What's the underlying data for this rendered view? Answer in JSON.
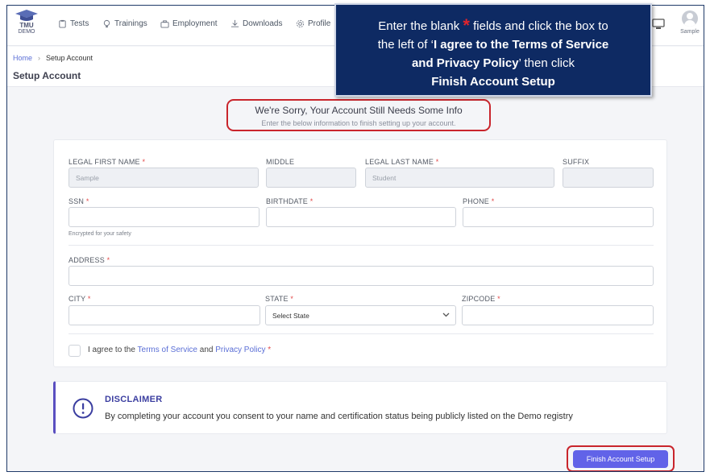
{
  "brand": {
    "logo_top": "TMU",
    "logo_bottom": "DEMO"
  },
  "nav": {
    "items": [
      {
        "label": "Tests",
        "icon": "clipboard-icon"
      },
      {
        "label": "Trainings",
        "icon": "lightbulb-icon"
      },
      {
        "label": "Employment",
        "icon": "briefcase-icon"
      },
      {
        "label": "Downloads",
        "icon": "download-icon"
      },
      {
        "label": "Profile",
        "icon": "gear-icon"
      }
    ],
    "user_name": "Sample"
  },
  "breadcrumb": {
    "home": "Home",
    "current": "Setup Account"
  },
  "page_title": "Setup Account",
  "callout": {
    "line1_a": "Enter the blank ",
    "line1_star": "*",
    "line1_b": " fields and click the box to",
    "line2_a": "the left of ‘",
    "line2_bold": "I agree to the Terms of Service",
    "line3_bold": "and Privacy Policy",
    "line3_b": "’ then click",
    "line4_bold": "Finish Account Setup"
  },
  "notice": {
    "heading": "We're Sorry, Your Account Still Needs Some Info",
    "subtext": "Enter the below information to finish setting up your account."
  },
  "form": {
    "first_name": {
      "label": "LEGAL FIRST NAME",
      "value": "Sample",
      "required": "*"
    },
    "middle": {
      "label": "MIDDLE",
      "value": ""
    },
    "last_name": {
      "label": "LEGAL LAST NAME",
      "value": "Student",
      "required": "*"
    },
    "suffix": {
      "label": "SUFFIX",
      "value": ""
    },
    "ssn": {
      "label": "SSN",
      "required": "*",
      "hint": "Encrypted for your safety"
    },
    "birthdate": {
      "label": "BIRTHDATE",
      "required": "*"
    },
    "phone": {
      "label": "PHONE",
      "required": "*"
    },
    "address": {
      "label": "ADDRESS",
      "required": "*"
    },
    "city": {
      "label": "CITY",
      "required": "*"
    },
    "state": {
      "label": "STATE",
      "required": "*",
      "selected": "Select State"
    },
    "zipcode": {
      "label": "ZIPCODE",
      "required": "*"
    },
    "agree": {
      "prefix": "I agree to the ",
      "terms": "Terms of Service",
      "mid": " and ",
      "privacy": "Privacy Policy",
      "required": "*"
    }
  },
  "disclaimer": {
    "title": "DISCLAIMER",
    "body": "By completing your account you consent to your name and certification status being publicly listed on the Demo registry"
  },
  "finish_button": "Finish Account Setup",
  "colors": {
    "primary": "#6163e8",
    "callout_bg": "#0e2a63",
    "highlight": "#c9252c",
    "required": "#e24a4a",
    "link": "#5b6fd6"
  }
}
